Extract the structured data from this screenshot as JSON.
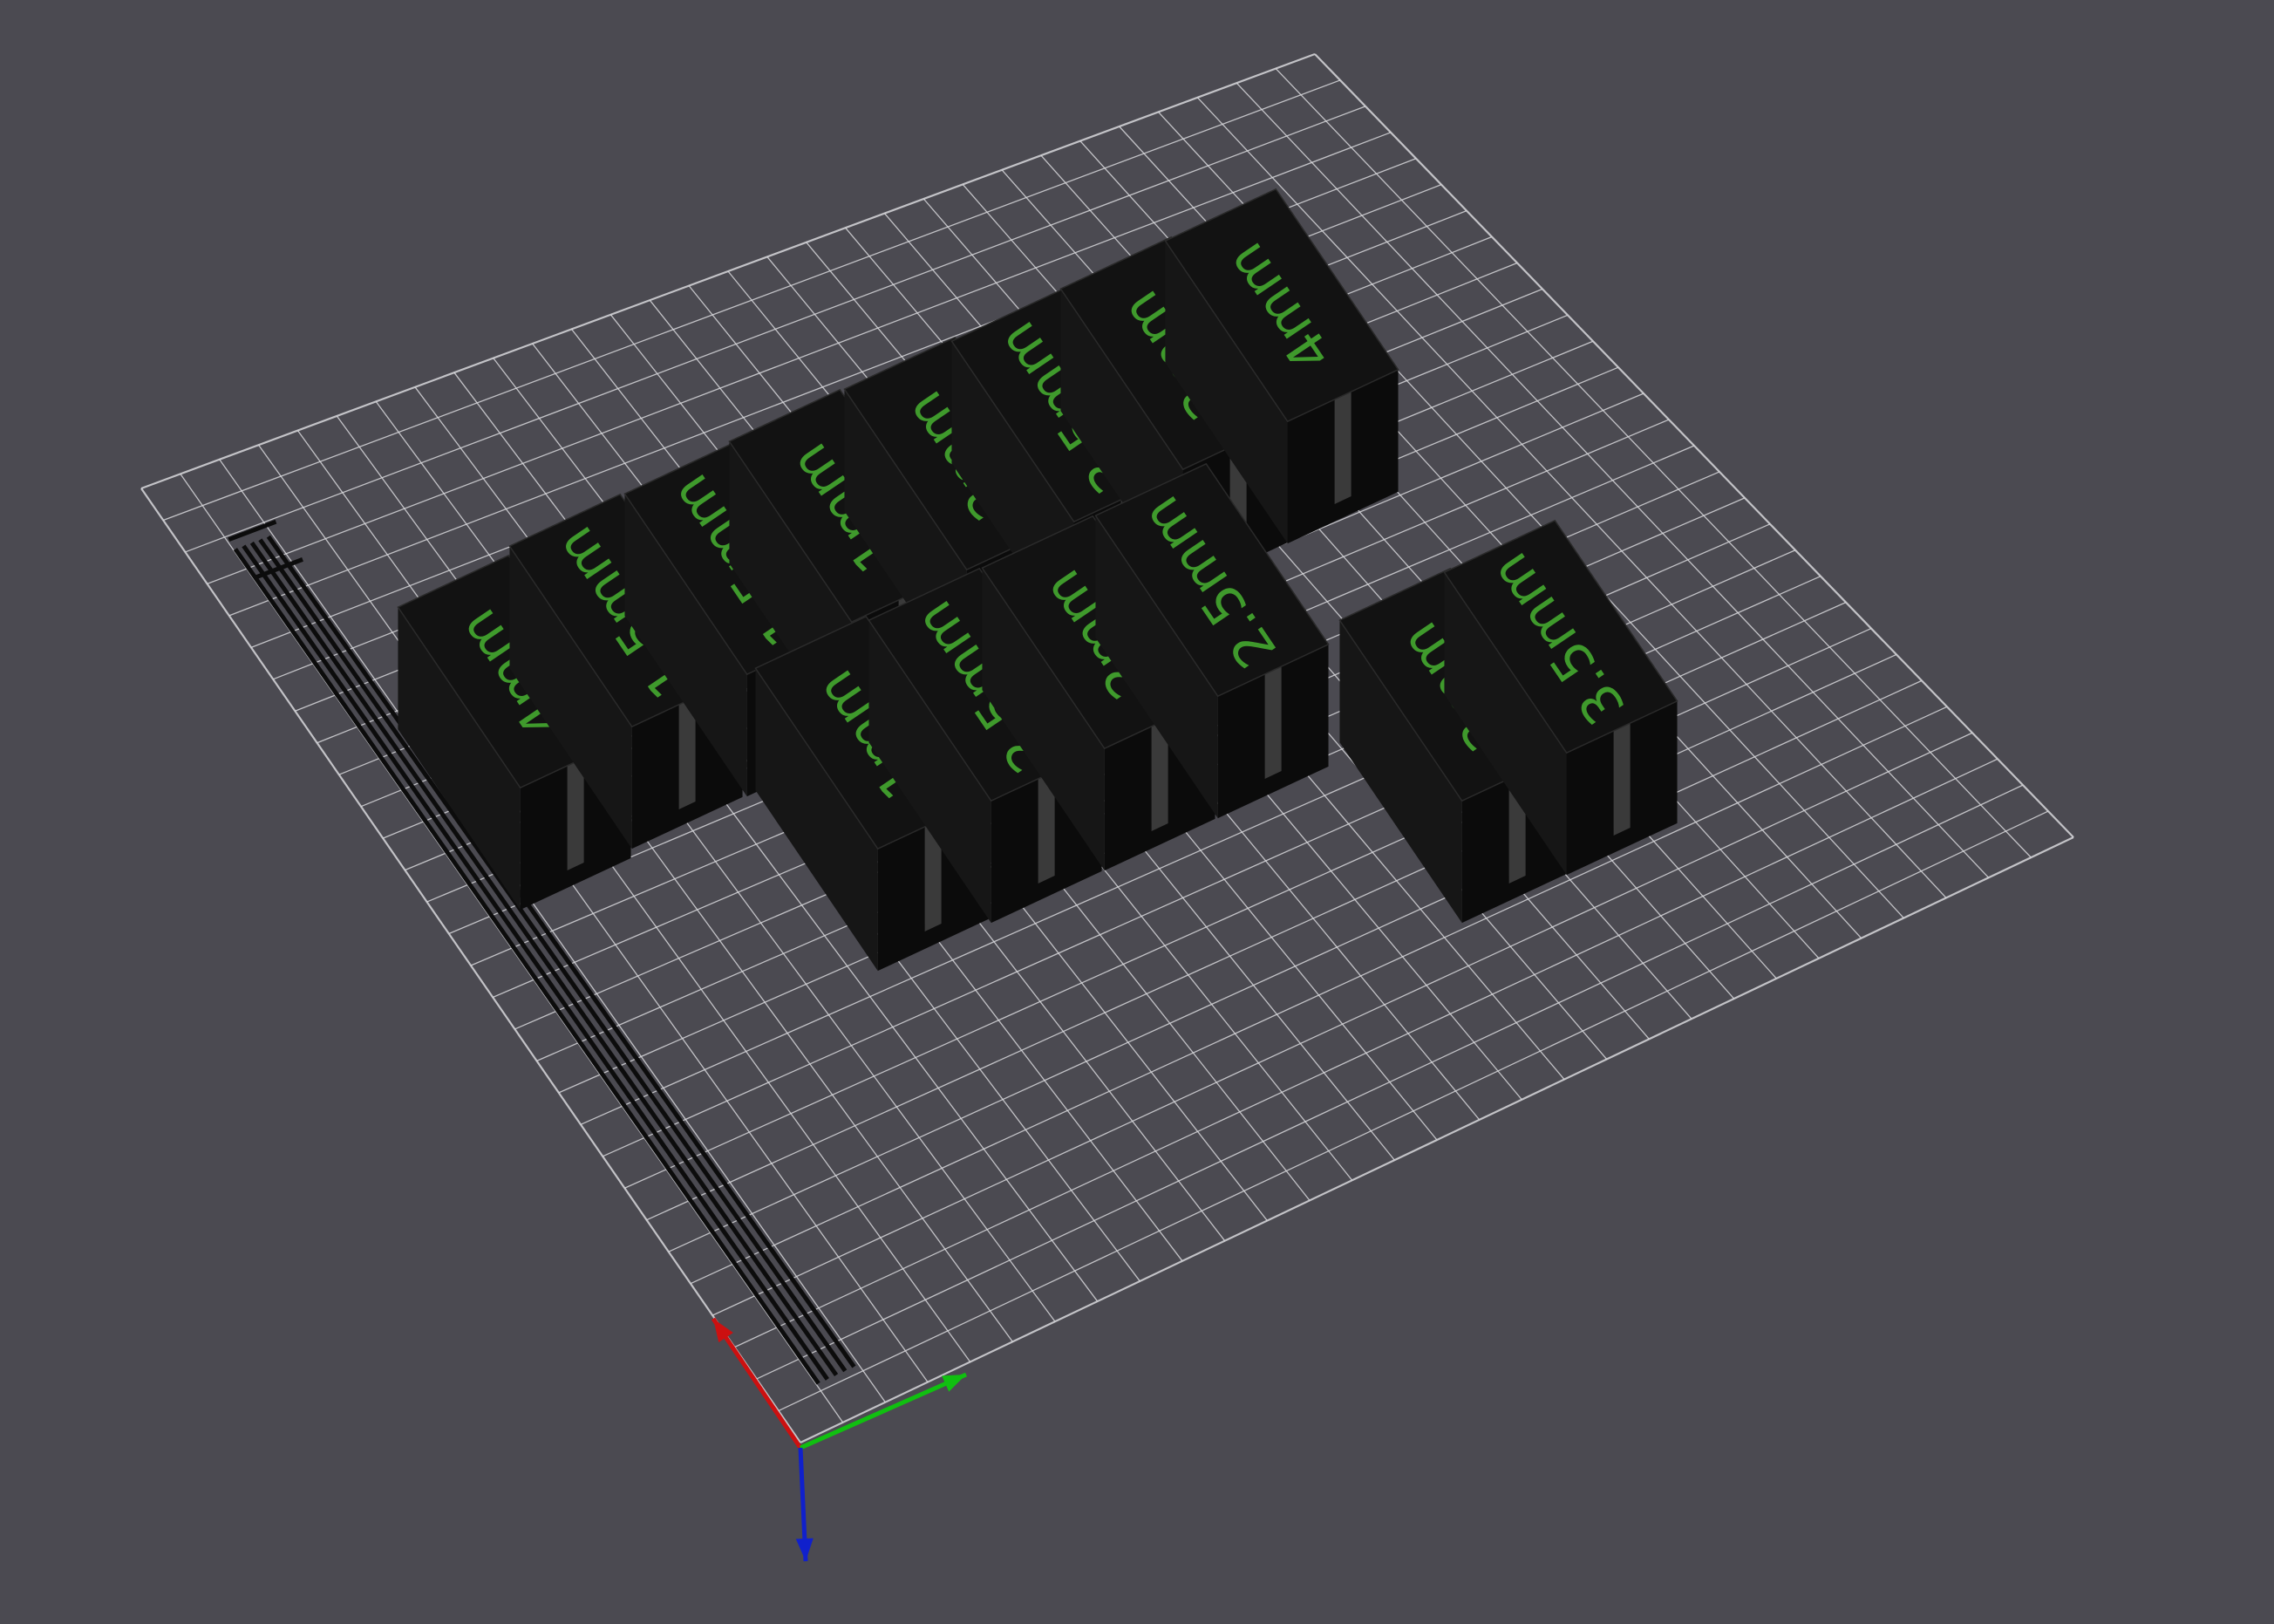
{
  "viewport": {
    "background_color": "#4b4a51",
    "bed_grid_color": "#d8d8dc",
    "part_color": "#121212",
    "label_color": "#3f9a2c"
  },
  "axes": {
    "x_color": "#cc1010",
    "y_color": "#10c010",
    "z_color": "#1020cc"
  },
  "parts": [
    {
      "id": "p1",
      "label": "4mm"
    },
    {
      "id": "p2",
      "label": "1.5mm"
    },
    {
      "id": "p3",
      "label": "1.5mm"
    },
    {
      "id": "p4",
      "label": "1mm"
    },
    {
      "id": "p5",
      "label": "2mm"
    },
    {
      "id": "p6",
      "label": "3.5mm"
    },
    {
      "id": "p7",
      "label": "3mm"
    },
    {
      "id": "p8",
      "label": "4mm"
    },
    {
      "id": "p9",
      "label": "1mm"
    },
    {
      "id": "p10",
      "label": "2.5mm"
    },
    {
      "id": "p11",
      "label": "2mm"
    },
    {
      "id": "p12",
      "label": "2.5mm"
    },
    {
      "id": "p13",
      "label": "3mm"
    },
    {
      "id": "p14",
      "label": "3.5mm"
    }
  ]
}
